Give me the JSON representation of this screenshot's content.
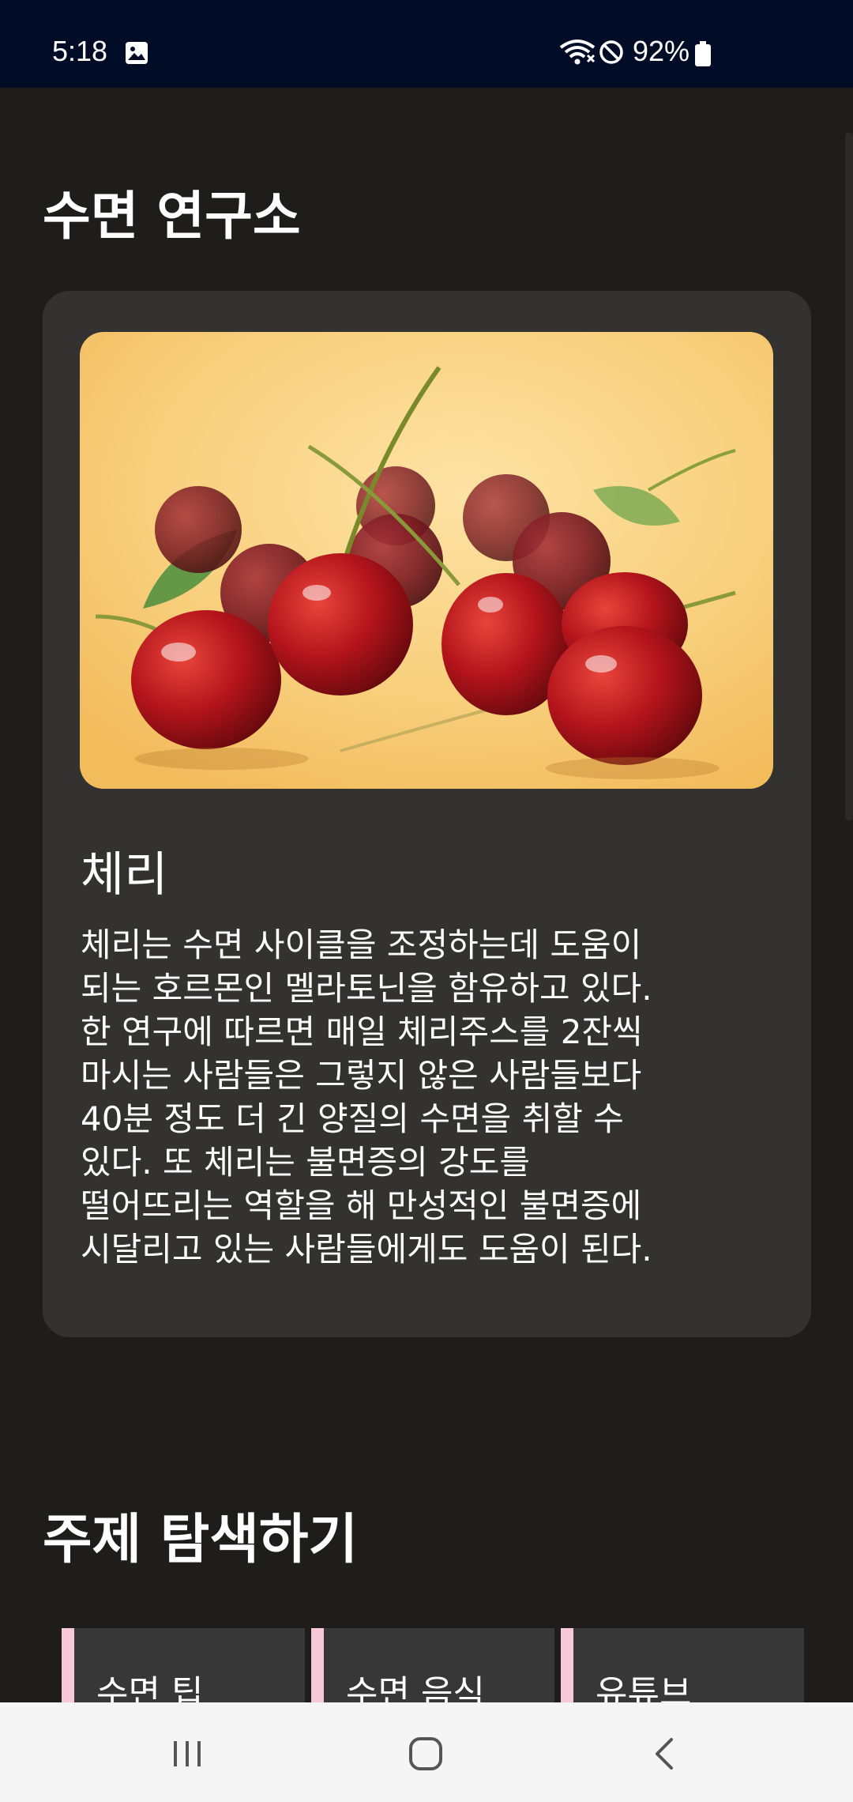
{
  "status_bar": {
    "time": "5:18",
    "battery": "92%",
    "icons": [
      "gallery-icon",
      "wifi-icon",
      "do-not-disturb-icon",
      "battery-icon"
    ]
  },
  "page": {
    "title": "수면 연구소"
  },
  "card": {
    "image": "cherries-photo",
    "title": "체리",
    "body_lines": [
      "체리는 수면 사이클을 조정하는데 도움이",
      "되는 호르몬인 멜라토닌을 함유하고 있다.",
      "한 연구에 따르면 매일 체리주스를 2잔씩",
      "마시는 사람들은 그렇지 않은 사람들보다",
      "40분 정도 더 긴 양질의 수면을 취할 수",
      "있다. 또 체리는 불면증의 강도를",
      "떨어뜨리는 역할을 해 만성적인 불면증에",
      "시달리고 있는 사람들에게도 도움이 된다."
    ]
  },
  "explore": {
    "title": "주제 탐색하기",
    "topics": [
      {
        "label": "수면 팁"
      },
      {
        "label": "수면 음식"
      },
      {
        "label": "유튜브"
      }
    ],
    "accent_color": "#f7c9d8"
  },
  "nav_bar": {
    "buttons": [
      "recent-apps-icon",
      "home-icon",
      "back-icon"
    ]
  },
  "colors": {
    "background": "#1e1d1c",
    "card": "#333231",
    "status_bar": "#010d27"
  }
}
